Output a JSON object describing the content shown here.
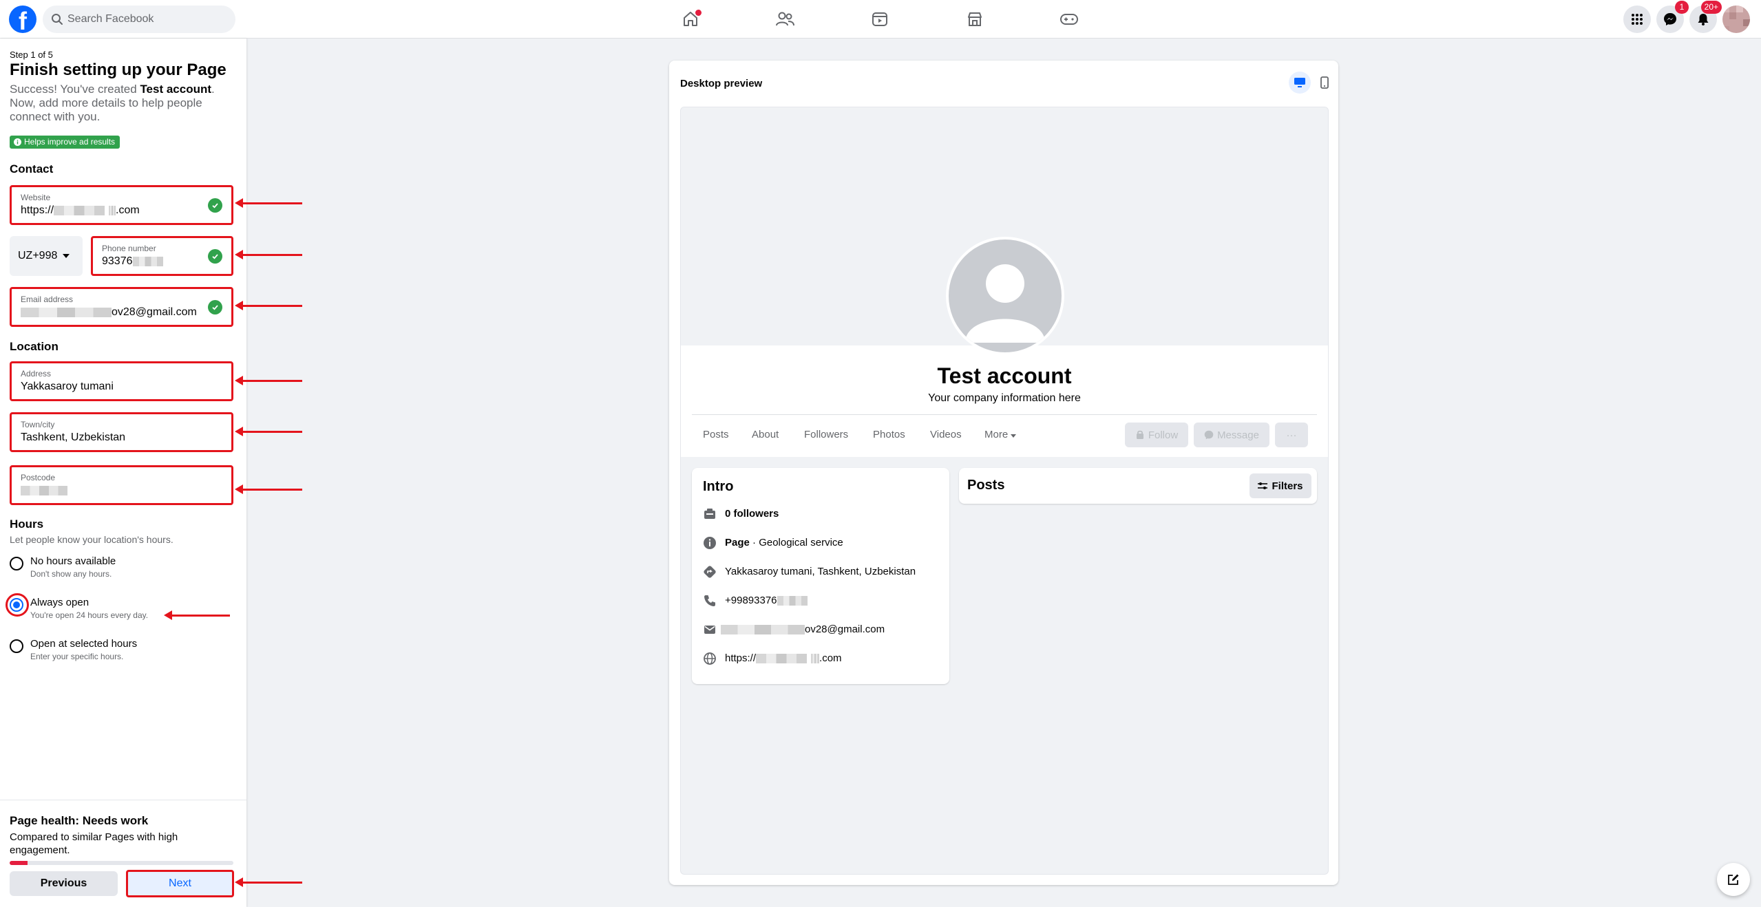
{
  "topbar": {
    "logo": "f",
    "search_placeholder": "Search Facebook",
    "messenger_badge": "1",
    "notifications_badge": "20+"
  },
  "sidebar": {
    "step": "Step 1 of 5",
    "title": "Finish setting up your Page",
    "intro_prefix": "Success! You've created ",
    "intro_page_name": "Test account",
    "intro_suffix": ". Now, add more details to help people connect with you.",
    "tag": "Helps improve ad results",
    "contact_heading": "Contact",
    "website": {
      "label": "Website",
      "value_prefix": "https://",
      "value_suffix": ".com"
    },
    "country_code": "UZ+998",
    "phone": {
      "label": "Phone number",
      "value_prefix": "93376"
    },
    "email": {
      "label": "Email address",
      "value_suffix": "ov28@gmail.com"
    },
    "location_heading": "Location",
    "address": {
      "label": "Address",
      "value": "Yakkasaroy tumani"
    },
    "town": {
      "label": "Town/city",
      "value": "Tashkent, Uzbekistan"
    },
    "postcode": {
      "label": "Postcode"
    },
    "hours_heading": "Hours",
    "hours_sub": "Let people know your location's hours.",
    "hours_options": [
      {
        "title": "No hours available",
        "sub": "Don't show any hours.",
        "selected": false
      },
      {
        "title": "Always open",
        "sub": "You're open 24 hours every day.",
        "selected": true
      },
      {
        "title": "Open at selected hours",
        "sub": "Enter your specific hours.",
        "selected": false
      }
    ],
    "health_title": "Page health: Needs work",
    "health_sub": "Compared to similar Pages with high engagement.",
    "health_progress_pct": 8,
    "previous_label": "Previous",
    "next_label": "Next"
  },
  "preview": {
    "title": "Desktop preview",
    "page_name": "Test account",
    "page_desc": "Your company information here",
    "tabs": [
      "Posts",
      "About",
      "Followers",
      "Photos",
      "Videos",
      "More"
    ],
    "follow_label": "Follow",
    "message_label": "Message",
    "more_label": "···",
    "intro_title": "Intro",
    "followers": "0 followers",
    "category_bold": "Page",
    "category_rest": " · Geological service",
    "address": "Yakkasaroy tumani, Tashkent, Uzbekistan",
    "phone_prefix": "+99893376",
    "email_suffix": "ov28@gmail.com",
    "website_prefix": "https://",
    "website_suffix": ".com",
    "posts_title": "Posts",
    "filters_label": "Filters"
  },
  "colors": {
    "accent": "#0866ff",
    "annotation_red": "#e4141c",
    "success_green": "#31a24c",
    "badge_red": "#e41e3f"
  }
}
